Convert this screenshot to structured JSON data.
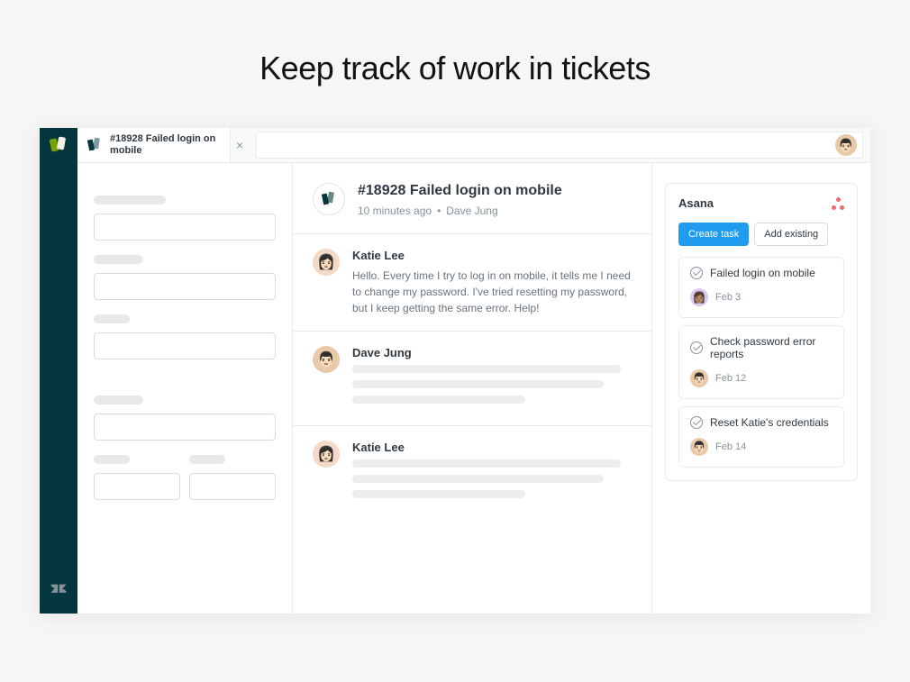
{
  "page": {
    "heading": "Keep track of work in tickets"
  },
  "tab": {
    "title": "#18928 Failed login on mobile"
  },
  "ticket": {
    "title": "#18928 Failed login on mobile",
    "timestamp": "10 minutes ago",
    "author": "Dave Jung"
  },
  "messages": [
    {
      "author": "Katie Lee",
      "text": "Hello. Every time I try to log in on mobile, it tells me I need to change my password. I've tried resetting my password, but I keep getting the same error. Help!"
    },
    {
      "author": "Dave Jung",
      "text": ""
    },
    {
      "author": "Katie Lee",
      "text": ""
    }
  ],
  "asana": {
    "title": "Asana",
    "create_label": "Create task",
    "add_label": "Add existing",
    "tasks": [
      {
        "title": "Failed login on mobile",
        "date": "Feb 3",
        "avatar": "purple"
      },
      {
        "title": "Check password error reports",
        "date": "Feb 12",
        "avatar": "dave"
      },
      {
        "title": "Reset Katie's credentials",
        "date": "Feb 14",
        "avatar": "dave"
      }
    ]
  }
}
